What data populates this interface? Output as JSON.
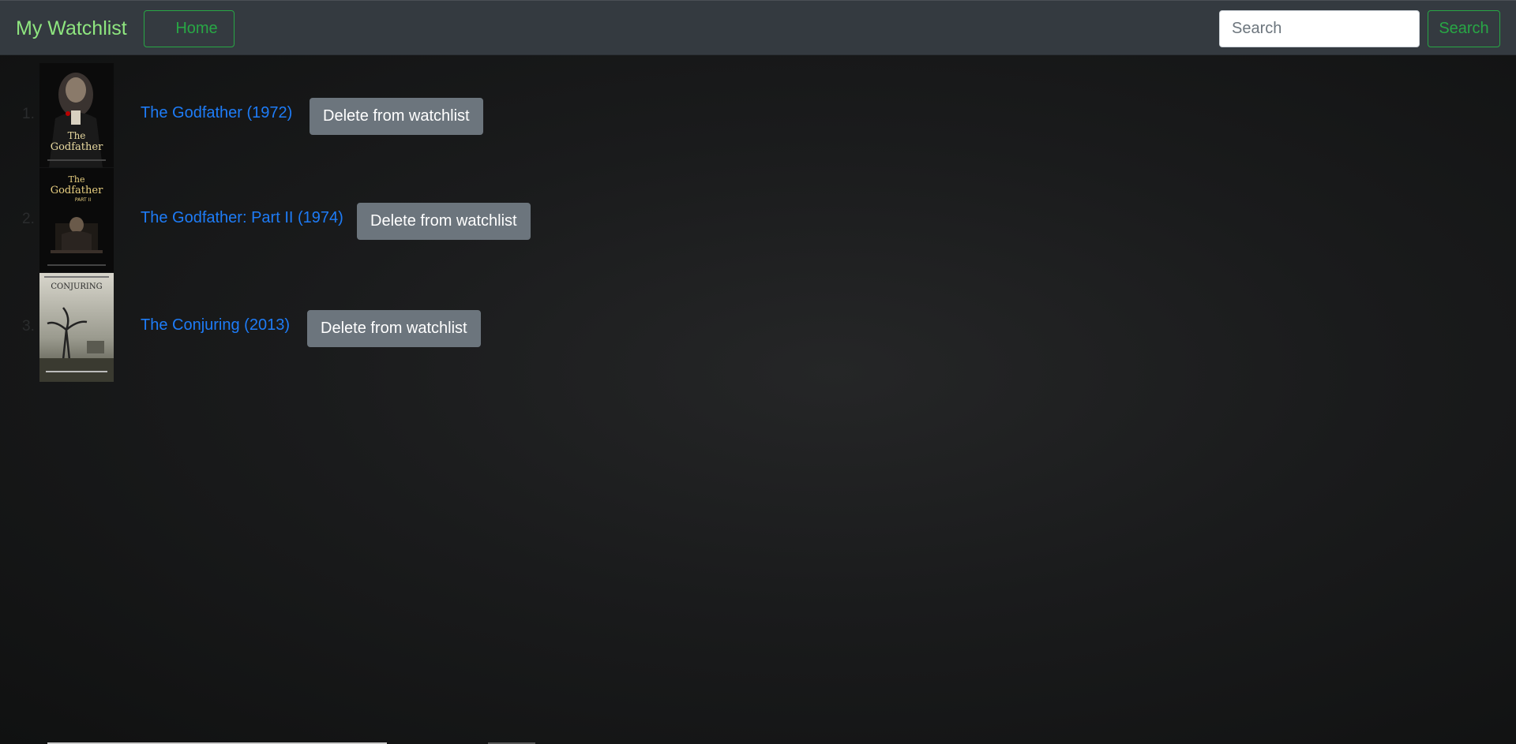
{
  "app": {
    "brand": "My Watchlist"
  },
  "nav": {
    "home_label": "Home",
    "search_placeholder": "Search",
    "search_value": "",
    "search_button_label": "Search"
  },
  "colors": {
    "brand": "#8ee57f",
    "navbar_bg": "#343a40",
    "success_outline": "#28a745",
    "link": "#1e7cf7",
    "secondary_button": "#6c757d"
  },
  "watchlist": {
    "items": [
      {
        "number": "1.",
        "title": "The Godfather (1972)",
        "delete_label": "Delete from watchlist",
        "poster_icon": "godfather-poster"
      },
      {
        "number": "2.",
        "title": "The Godfather: Part II (1974)",
        "delete_label": "Delete from watchlist",
        "poster_icon": "godfather-part-2-poster"
      },
      {
        "number": "3.",
        "title": "The Conjuring (2013)",
        "delete_label": "Delete from watchlist",
        "poster_icon": "the-conjuring-poster"
      }
    ]
  }
}
